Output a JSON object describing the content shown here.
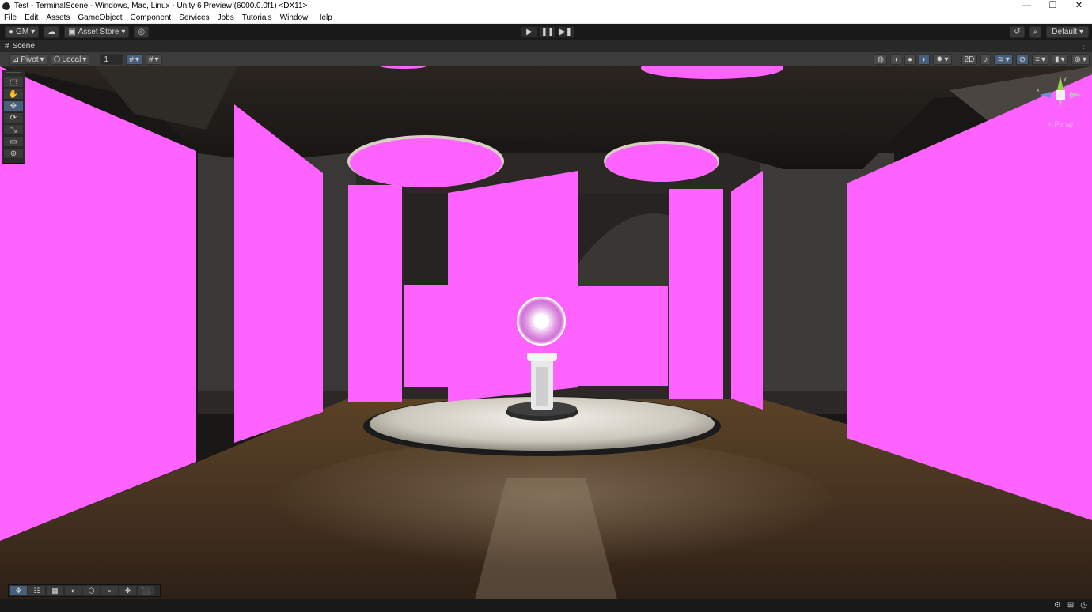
{
  "window": {
    "title": "Test - TerminalScene - Windows, Mac, Linux - Unity 6 Preview (6000.0.0f1) <DX11>",
    "controls": [
      "—",
      "❐",
      "✕"
    ]
  },
  "menu": [
    "File",
    "Edit",
    "Assets",
    "GameObject",
    "Component",
    "Services",
    "Jobs",
    "Tutorials",
    "Window",
    "Help"
  ],
  "toolbar": {
    "account_label": "GM",
    "asset_store_label": "Asset Store",
    "play_icons": [
      "▶",
      "❚❚",
      "▶❚"
    ],
    "layout_label": "Default"
  },
  "scene_tab": {
    "label": "Scene",
    "more": "⋮"
  },
  "scene_toolbar": {
    "pivot_label": "Pivot",
    "local_label": "Local",
    "grid_value": "1",
    "mode_2d": "2D"
  },
  "tools": [
    "⬚",
    "✋",
    "✥",
    "⟳",
    "⤡",
    "▭",
    "⊕"
  ],
  "gizmo": {
    "persp_label": "< Persp",
    "x_label": "x",
    "y_label": "y"
  },
  "overlay_tools": [
    "✥",
    "☷",
    "▦",
    "◐",
    "⬡",
    "⌕",
    "✥",
    "⬛"
  ],
  "status_icons": [
    "⚙",
    "⊞",
    "◎"
  ],
  "colors": {
    "magenta": "#ff63ff",
    "toolbar_bg": "#191919",
    "active_blue": "#46607c"
  }
}
